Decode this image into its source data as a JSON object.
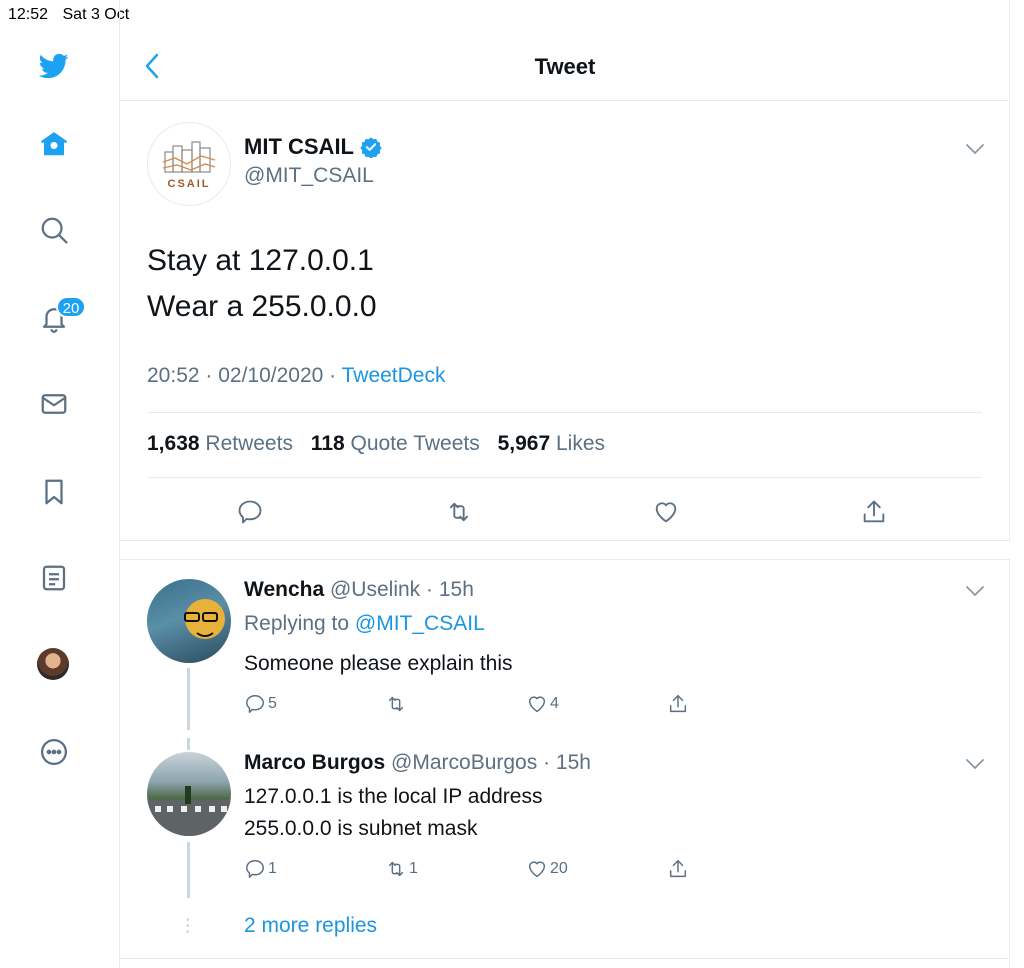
{
  "status_bar": {
    "time": "12:52",
    "date": "Sat 3 Oct"
  },
  "sidebar": {
    "items": [
      {
        "name": "twitter-logo",
        "icon": "twitter-bird-icon"
      },
      {
        "name": "home",
        "icon": "home-icon"
      },
      {
        "name": "explore",
        "icon": "search-icon"
      },
      {
        "name": "notifications",
        "icon": "bell-icon",
        "badge": "20"
      },
      {
        "name": "messages",
        "icon": "mail-icon"
      },
      {
        "name": "bookmarks",
        "icon": "bookmark-icon"
      },
      {
        "name": "lists",
        "icon": "list-icon"
      },
      {
        "name": "profile",
        "icon": "avatar"
      },
      {
        "name": "more",
        "icon": "more-icon"
      }
    ],
    "notification_badge": "20"
  },
  "header": {
    "title": "Tweet"
  },
  "tweet": {
    "author_name": "MIT CSAIL",
    "author_handle": "@MIT_CSAIL",
    "avatar_text": "CSAIL",
    "text_line1": "Stay at 127.0.0.1",
    "text_line2": "Wear a 255.0.0.0",
    "timestamp": "20:52 · 02/10/2020 · ",
    "source": "TweetDeck",
    "retweets_count": "1,638",
    "retweets_label": "Retweets",
    "quotes_count": "118",
    "quotes_label": "Quote Tweets",
    "likes_count": "5,967",
    "likes_label": "Likes"
  },
  "replies": [
    {
      "name": "Wencha",
      "handle": "@Uselink",
      "time": "· 15h",
      "replying_label": "Replying to ",
      "replying_to": "@MIT_CSAIL",
      "text_line1": "Someone please explain this",
      "reply_count": "5",
      "retweet_count": "",
      "like_count": "4"
    },
    {
      "name": "Marco Burgos",
      "handle": "@MarcoBurgos",
      "time": "· 15h",
      "text_line1": "127.0.0.1 is the local IP address",
      "text_line2": "255.0.0.0 is subnet mask",
      "reply_count": "1",
      "retweet_count": "1",
      "like_count": "20"
    }
  ],
  "more_replies": "2 more replies",
  "colors": {
    "accent": "#1da1f2",
    "link": "#1b95e0",
    "muted": "#5b7083",
    "border": "#e6ecf0"
  }
}
